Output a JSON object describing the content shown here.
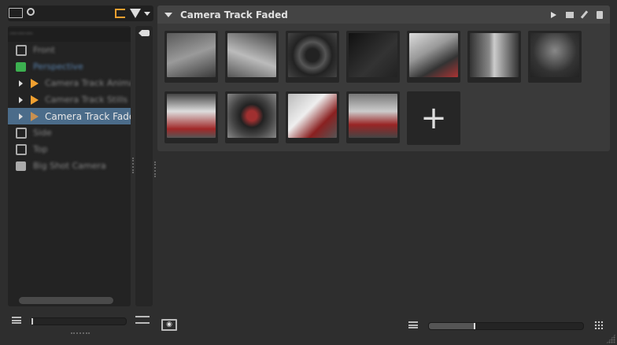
{
  "outliner": {
    "items": [
      {
        "label": "Front",
        "type": "camera",
        "selected": false
      },
      {
        "label": "Perspective",
        "type": "perspective-camera",
        "selected": false
      },
      {
        "label": "Camera Track Animation",
        "type": "track",
        "selected": false
      },
      {
        "label": "Camera Track Stills",
        "type": "track",
        "selected": false
      },
      {
        "label": "Camera Track Faded",
        "type": "track",
        "selected": true
      },
      {
        "label": "Side",
        "type": "camera",
        "selected": false
      },
      {
        "label": "Top",
        "type": "camera",
        "selected": false
      },
      {
        "label": "Big Shot Camera",
        "type": "camera",
        "selected": false
      }
    ],
    "zoom_slider": 0
  },
  "track": {
    "title": "Camera Track Faded",
    "thumbnails": [
      "car-front-3q",
      "car-front-detail",
      "wheel",
      "headlight",
      "car-side-detail",
      "taillight",
      "car-rear",
      "interior-dash",
      "steering-wheel",
      "seat",
      "interior-seats"
    ],
    "add_label": "+",
    "size_slider": 0.3
  },
  "colors": {
    "accent": "#f0a030",
    "selection": "#4b6c8a",
    "perspective": "#3cb050"
  }
}
